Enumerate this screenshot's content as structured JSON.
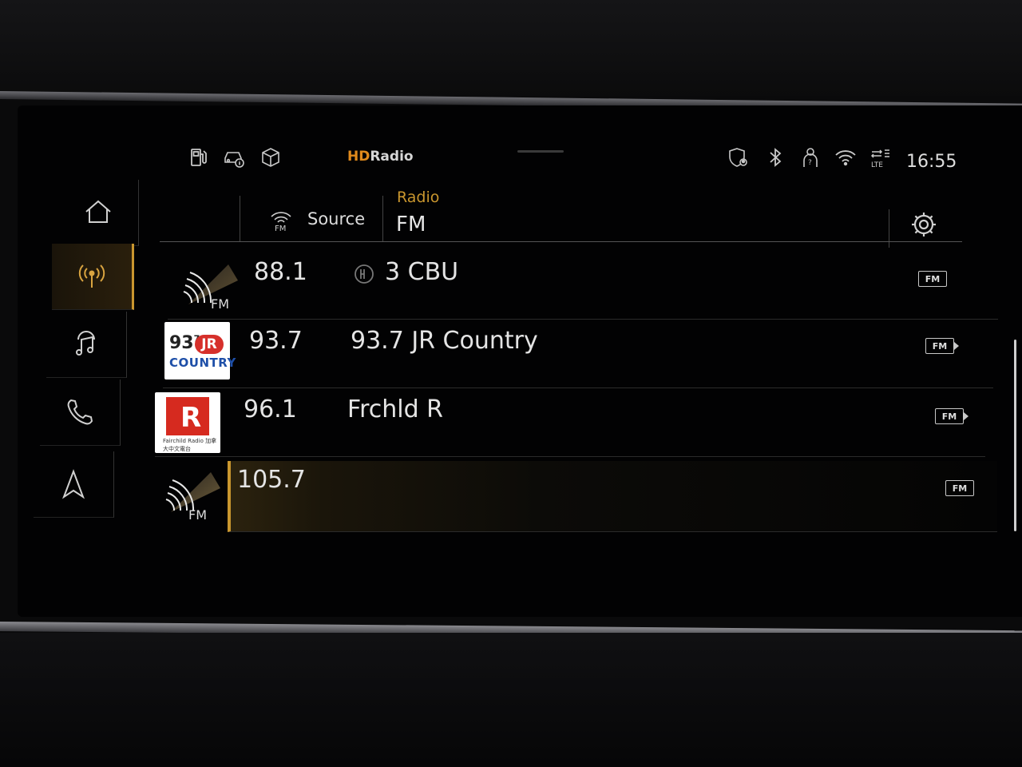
{
  "status_bar": {
    "icons": [
      "fuel-icon",
      "car-info-icon",
      "cube-icon",
      "location-shield-icon",
      "bluetooth-icon",
      "user-icon",
      "wifi-icon",
      "lte-icon"
    ],
    "hd_logo_hd": "HD",
    "hd_logo_text": "Radio",
    "time": "16:55"
  },
  "nav": {
    "items": [
      "home-icon",
      "radio-icon",
      "music-icon",
      "phone-icon",
      "navigation-icon"
    ],
    "active": "radio"
  },
  "header": {
    "source_label": "Source",
    "source_icon_text": "FM",
    "section_label": "Radio",
    "band_title": "FM",
    "settings_icon": "gear-icon"
  },
  "stations": [
    {
      "freq": "88.1",
      "name": "3 CBU",
      "hd": true,
      "logo": "generic-fm",
      "logo_text": "FM",
      "tag": "FM"
    },
    {
      "freq": "93.7",
      "name": "93.7 JR Country",
      "hd": false,
      "logo": "jr-country",
      "logo_text": "93.7 JR COUNTRY",
      "tag": "FM"
    },
    {
      "freq": "96.1",
      "name": "Frchld R",
      "hd": false,
      "logo": "fairchild",
      "logo_text": "Fairchild Radio 加拿大中文電台",
      "tag": "FM"
    },
    {
      "freq": "105.7",
      "name": "",
      "hd": false,
      "logo": "generic-fm",
      "logo_text": "FM",
      "tag": "FM",
      "active": true
    }
  ],
  "jr_logo": {
    "top": "93",
    "sup": "7",
    "badge": "JR",
    "bottom": "COUNTRY"
  },
  "fairchild_logo": {
    "caption": "Fairchild Radio 加拿大中文電台"
  },
  "colors": {
    "accent": "#c9962e",
    "hd_orange": "#e08a1c",
    "background": "#020203"
  }
}
